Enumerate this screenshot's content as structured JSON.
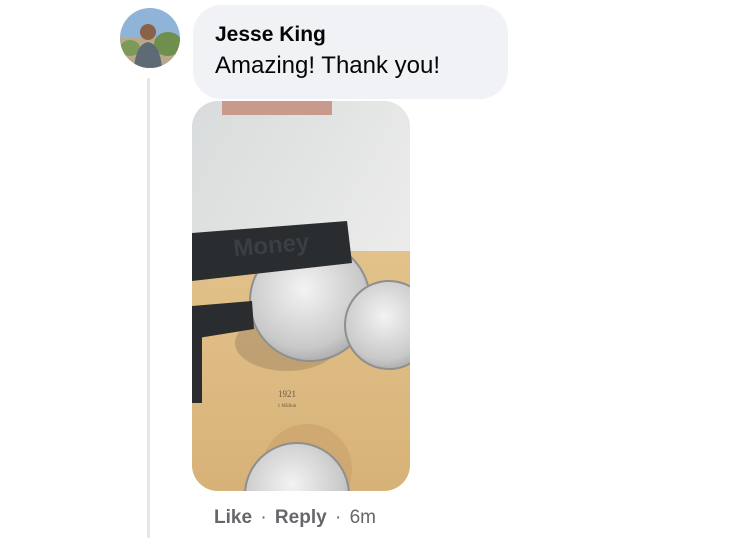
{
  "comment": {
    "author": "Jesse King",
    "text": "Amazing! Thank you!",
    "avatar_icon": "profile-photo",
    "photo": {
      "label_year": "1921",
      "label_mintage": "1 Million",
      "tool_text": "Money"
    }
  },
  "actions": {
    "like_label": "Like",
    "reply_label": "Reply",
    "separator": "·",
    "timestamp": "6m"
  },
  "colors": {
    "bubble_bg": "#f0f2f5",
    "text_primary": "#050505",
    "text_secondary": "#65676b",
    "thread_line": "#e4e6eb"
  }
}
